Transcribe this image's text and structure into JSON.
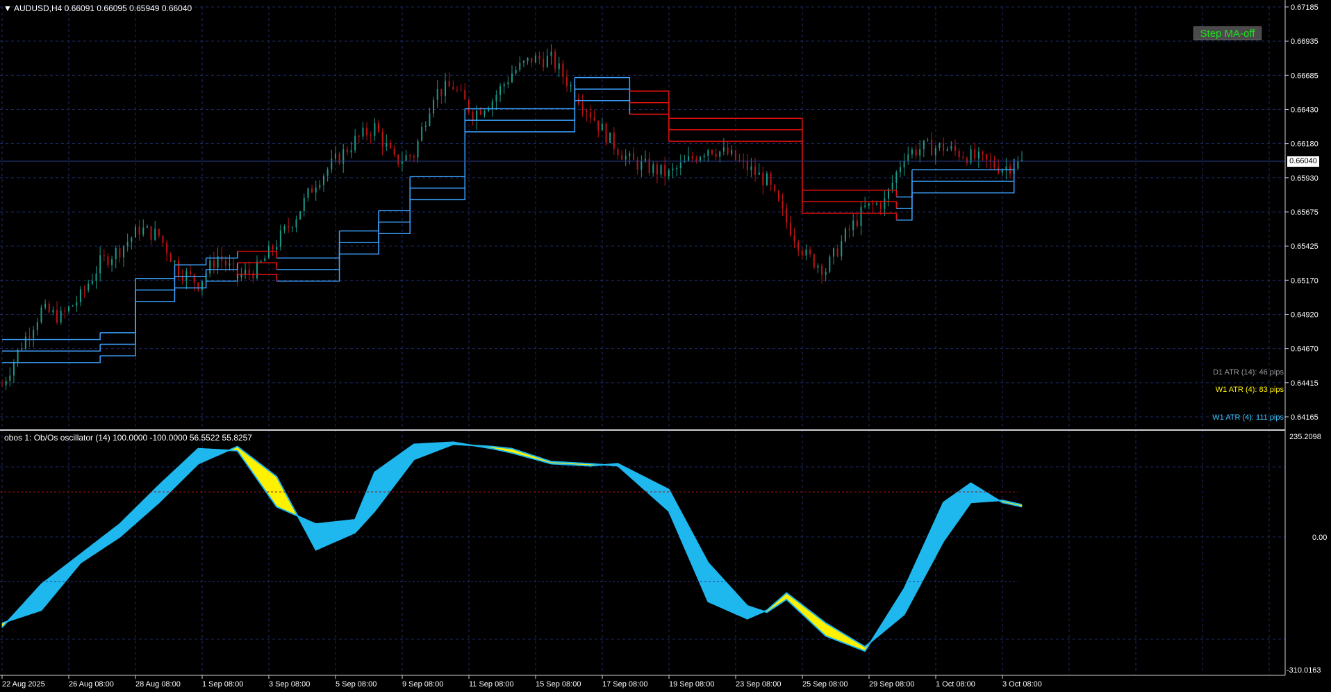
{
  "symbol_title": "AUDUSD,H4  0.66091 0.66095 0.65949 0.66040",
  "step_ma_button": "Step MA-off",
  "current_price": "0.66040",
  "price_axis": {
    "labels": [
      "0.67185",
      "0.66935",
      "0.66685",
      "0.66430",
      "0.66180",
      "0.65930",
      "0.65675",
      "0.65425",
      "0.65170",
      "0.64920",
      "0.64670",
      "0.64415",
      "0.64165"
    ],
    "max": 0.67185,
    "min": 0.64165
  },
  "atr": {
    "d1": "D1 ATR (14): 46 pips",
    "w1_yellow": "W1 ATR (4): 83 pips",
    "w1_cyan": "W1 ATR (4): 111 pips"
  },
  "oscillator": {
    "title": "obos 1: Ob/Os oscillator (14) 100.0000 -100.0000 56.5522 55.8257",
    "top_label": "235.2098",
    "mid_label": "0.00",
    "bottom_label": "-310.0163",
    "max": 235.2098,
    "min": -310.0163,
    "overbought": 100,
    "oversold": -100
  },
  "time_axis": [
    "22 Aug 2025",
    "26 Aug 08:00",
    "28 Aug 08:00",
    "1 Sep 08:00",
    "3 Sep 08:00",
    "5 Sep 08:00",
    "9 Sep 08:00",
    "11 Sep 08:00",
    "15 Sep 08:00",
    "17 Sep 08:00",
    "19 Sep 08:00",
    "23 Sep 08:00",
    "25 Sep 08:00",
    "29 Sep 08:00",
    "1 Oct 08:00",
    "3 Oct 08:00"
  ],
  "colors": {
    "background": "#000000",
    "grid": "#1e2a66",
    "bull_candle": "#1a9a8a",
    "bear_candle": "#c01414",
    "step_up": "#3da3ff",
    "step_down": "#e01010",
    "osc_fast": "#1fb8ee",
    "osc_slow_fill": "#fff200",
    "ob_os_line": "#a01010",
    "atr_d1": "#9a9a9a",
    "atr_w1_yellow": "#fff200",
    "atr_w1_cyan": "#3ec8ff"
  },
  "chart_data": [
    {
      "type": "candlestick",
      "title": "AUDUSD,H4",
      "ylim": [
        0.64165,
        0.67185
      ],
      "close_path": [
        [
          0,
          0.644
        ],
        [
          5,
          0.647
        ],
        [
          10,
          0.6495
        ],
        [
          15,
          0.649
        ],
        [
          20,
          0.6505
        ],
        [
          25,
          0.653
        ],
        [
          30,
          0.654
        ],
        [
          35,
          0.6555
        ],
        [
          40,
          0.655
        ],
        [
          45,
          0.6525
        ],
        [
          50,
          0.6515
        ],
        [
          55,
          0.6535
        ],
        [
          60,
          0.652
        ],
        [
          65,
          0.6525
        ],
        [
          70,
          0.6545
        ],
        [
          75,
          0.6565
        ],
        [
          80,
          0.659
        ],
        [
          85,
          0.6605
        ],
        [
          90,
          0.662
        ],
        [
          95,
          0.663
        ],
        [
          100,
          0.6605
        ],
        [
          105,
          0.661
        ],
        [
          110,
          0.6655
        ],
        [
          115,
          0.666
        ],
        [
          120,
          0.664
        ],
        [
          125,
          0.665
        ],
        [
          130,
          0.667
        ],
        [
          135,
          0.668
        ],
        [
          140,
          0.668
        ],
        [
          145,
          0.666
        ],
        [
          150,
          0.664
        ],
        [
          155,
          0.662
        ],
        [
          160,
          0.6605
        ],
        [
          165,
          0.66
        ],
        [
          170,
          0.6595
        ],
        [
          175,
          0.6605
        ],
        [
          180,
          0.6615
        ],
        [
          185,
          0.661
        ],
        [
          190,
          0.66
        ],
        [
          195,
          0.659
        ],
        [
          200,
          0.656
        ],
        [
          205,
          0.6535
        ],
        [
          210,
          0.6525
        ],
        [
          215,
          0.655
        ],
        [
          220,
          0.657
        ],
        [
          225,
          0.6575
        ],
        [
          230,
          0.661
        ],
        [
          235,
          0.6615
        ],
        [
          240,
          0.6615
        ],
        [
          245,
          0.661
        ],
        [
          250,
          0.6605
        ],
        [
          255,
          0.66
        ],
        [
          260,
          0.6604
        ]
      ],
      "step_ma": [
        [
          0,
          0.6465,
          "up"
        ],
        [
          25,
          0.647,
          "up"
        ],
        [
          34,
          0.651,
          "up"
        ],
        [
          44,
          0.652,
          "up"
        ],
        [
          52,
          0.6525,
          "up"
        ],
        [
          60,
          0.653,
          "down"
        ],
        [
          70,
          0.6525,
          "up"
        ],
        [
          86,
          0.6545,
          "up"
        ],
        [
          96,
          0.656,
          "up"
        ],
        [
          104,
          0.6585,
          "up"
        ],
        [
          118,
          0.6635,
          "up"
        ],
        [
          146,
          0.6658,
          "up"
        ],
        [
          160,
          0.6648,
          "down"
        ],
        [
          170,
          0.6628,
          "down"
        ],
        [
          204,
          0.6575,
          "down"
        ],
        [
          228,
          0.657,
          "up"
        ],
        [
          232,
          0.659,
          "up"
        ],
        [
          258,
          0.6598,
          "mix"
        ]
      ],
      "step_ma_offset": 0.00085
    },
    {
      "type": "area",
      "title": "obos 1: Ob/Os oscillator (14)",
      "ylim": [
        -310.0163,
        235.2098
      ],
      "series": [
        {
          "name": "fast",
          "values": [
            [
              0,
              -210
            ],
            [
              10,
              -110
            ],
            [
              20,
              -40
            ],
            [
              30,
              30
            ],
            [
              40,
              120
            ],
            [
              50,
              205
            ],
            [
              60,
              200
            ],
            [
              70,
              70
            ],
            [
              80,
              30
            ],
            [
              90,
              40
            ],
            [
              95,
              150
            ],
            [
              105,
              215
            ],
            [
              115,
              220
            ],
            [
              125,
              205
            ],
            [
              130,
              195
            ],
            [
              140,
              170
            ],
            [
              150,
              165
            ],
            [
              157,
              170
            ],
            [
              170,
              110
            ],
            [
              180,
              -60
            ],
            [
              190,
              -160
            ],
            [
              195,
              -175
            ],
            [
              200,
              -145
            ],
            [
              210,
              -230
            ],
            [
              220,
              -265
            ],
            [
              230,
              -120
            ],
            [
              240,
              80
            ],
            [
              247,
              125
            ],
            [
              255,
              80
            ],
            [
              260,
              70
            ]
          ]
        },
        {
          "name": "slow",
          "values": [
            [
              0,
              -200
            ],
            [
              10,
              -170
            ],
            [
              20,
              -60
            ],
            [
              30,
              0
            ],
            [
              40,
              80
            ],
            [
              50,
              170
            ],
            [
              60,
              210
            ],
            [
              70,
              140
            ],
            [
              80,
              -30
            ],
            [
              90,
              10
            ],
            [
              95,
              60
            ],
            [
              105,
              180
            ],
            [
              115,
              215
            ],
            [
              125,
              210
            ],
            [
              130,
              205
            ],
            [
              140,
              175
            ],
            [
              150,
              170
            ],
            [
              157,
              165
            ],
            [
              170,
              60
            ],
            [
              180,
              -150
            ],
            [
              190,
              -190
            ],
            [
              195,
              -170
            ],
            [
              200,
              -130
            ],
            [
              210,
              -200
            ],
            [
              220,
              -255
            ],
            [
              230,
              -180
            ],
            [
              240,
              -10
            ],
            [
              247,
              80
            ],
            [
              255,
              85
            ],
            [
              260,
              75
            ]
          ]
        }
      ]
    }
  ]
}
